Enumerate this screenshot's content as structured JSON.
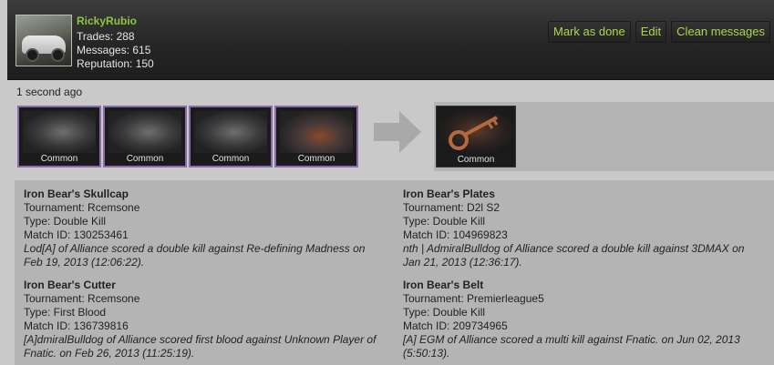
{
  "user": {
    "name": "RickyRubio",
    "trades": "Trades: 288",
    "messages": "Messages: 615",
    "reputation": "Reputation: 150"
  },
  "actions": {
    "mark_done": "Mark as done",
    "edit": "Edit",
    "clean": "Clean messages"
  },
  "timestamp": "1 second ago",
  "given_items": [
    {
      "rarity": "Common"
    },
    {
      "rarity": "Common"
    },
    {
      "rarity": "Common"
    },
    {
      "rarity": "Common"
    }
  ],
  "received_items": [
    {
      "rarity": "Common"
    }
  ],
  "details": [
    {
      "name": "Iron Bear's Skullcap",
      "tournament": "Tournament: Rcemsone",
      "type": "Type: Double Kill",
      "match": "Match ID: 130253461",
      "desc1": "Lod[A] of Alliance scored a double kill against Re-defining Madness on",
      "desc2": "Feb 19, 2013 (12:06:22)."
    },
    {
      "name": "Iron Bear's Plates",
      "tournament": "Tournament: D2l S2",
      "type": "Type: Double Kill",
      "match": "Match ID: 104969823",
      "desc1": "nth | AdmiralBulldog of Alliance scored a double kill against 3DMAX on",
      "desc2": "Jan 21, 2013 (12:36:17)."
    },
    {
      "name": "Iron Bear's Cutter",
      "tournament": "Tournament: Rcemsone",
      "type": "Type: First Blood",
      "match": "Match ID: 136739816",
      "desc1": "[A]dmiralBulldog of Alliance scored first blood against Unknown Player of",
      "desc2": "Fnatic. on Feb 26, 2013 (11:25:19)."
    },
    {
      "name": "Iron Bear's Belt",
      "tournament": "Tournament: Premierleague5",
      "type": "Type: Double Kill",
      "match": "Match ID: 209734965",
      "desc1": "[A] EGM of Alliance scored a multi kill against Fnatic. on Jun 02, 2013",
      "desc2": "(5:50:13)."
    }
  ]
}
